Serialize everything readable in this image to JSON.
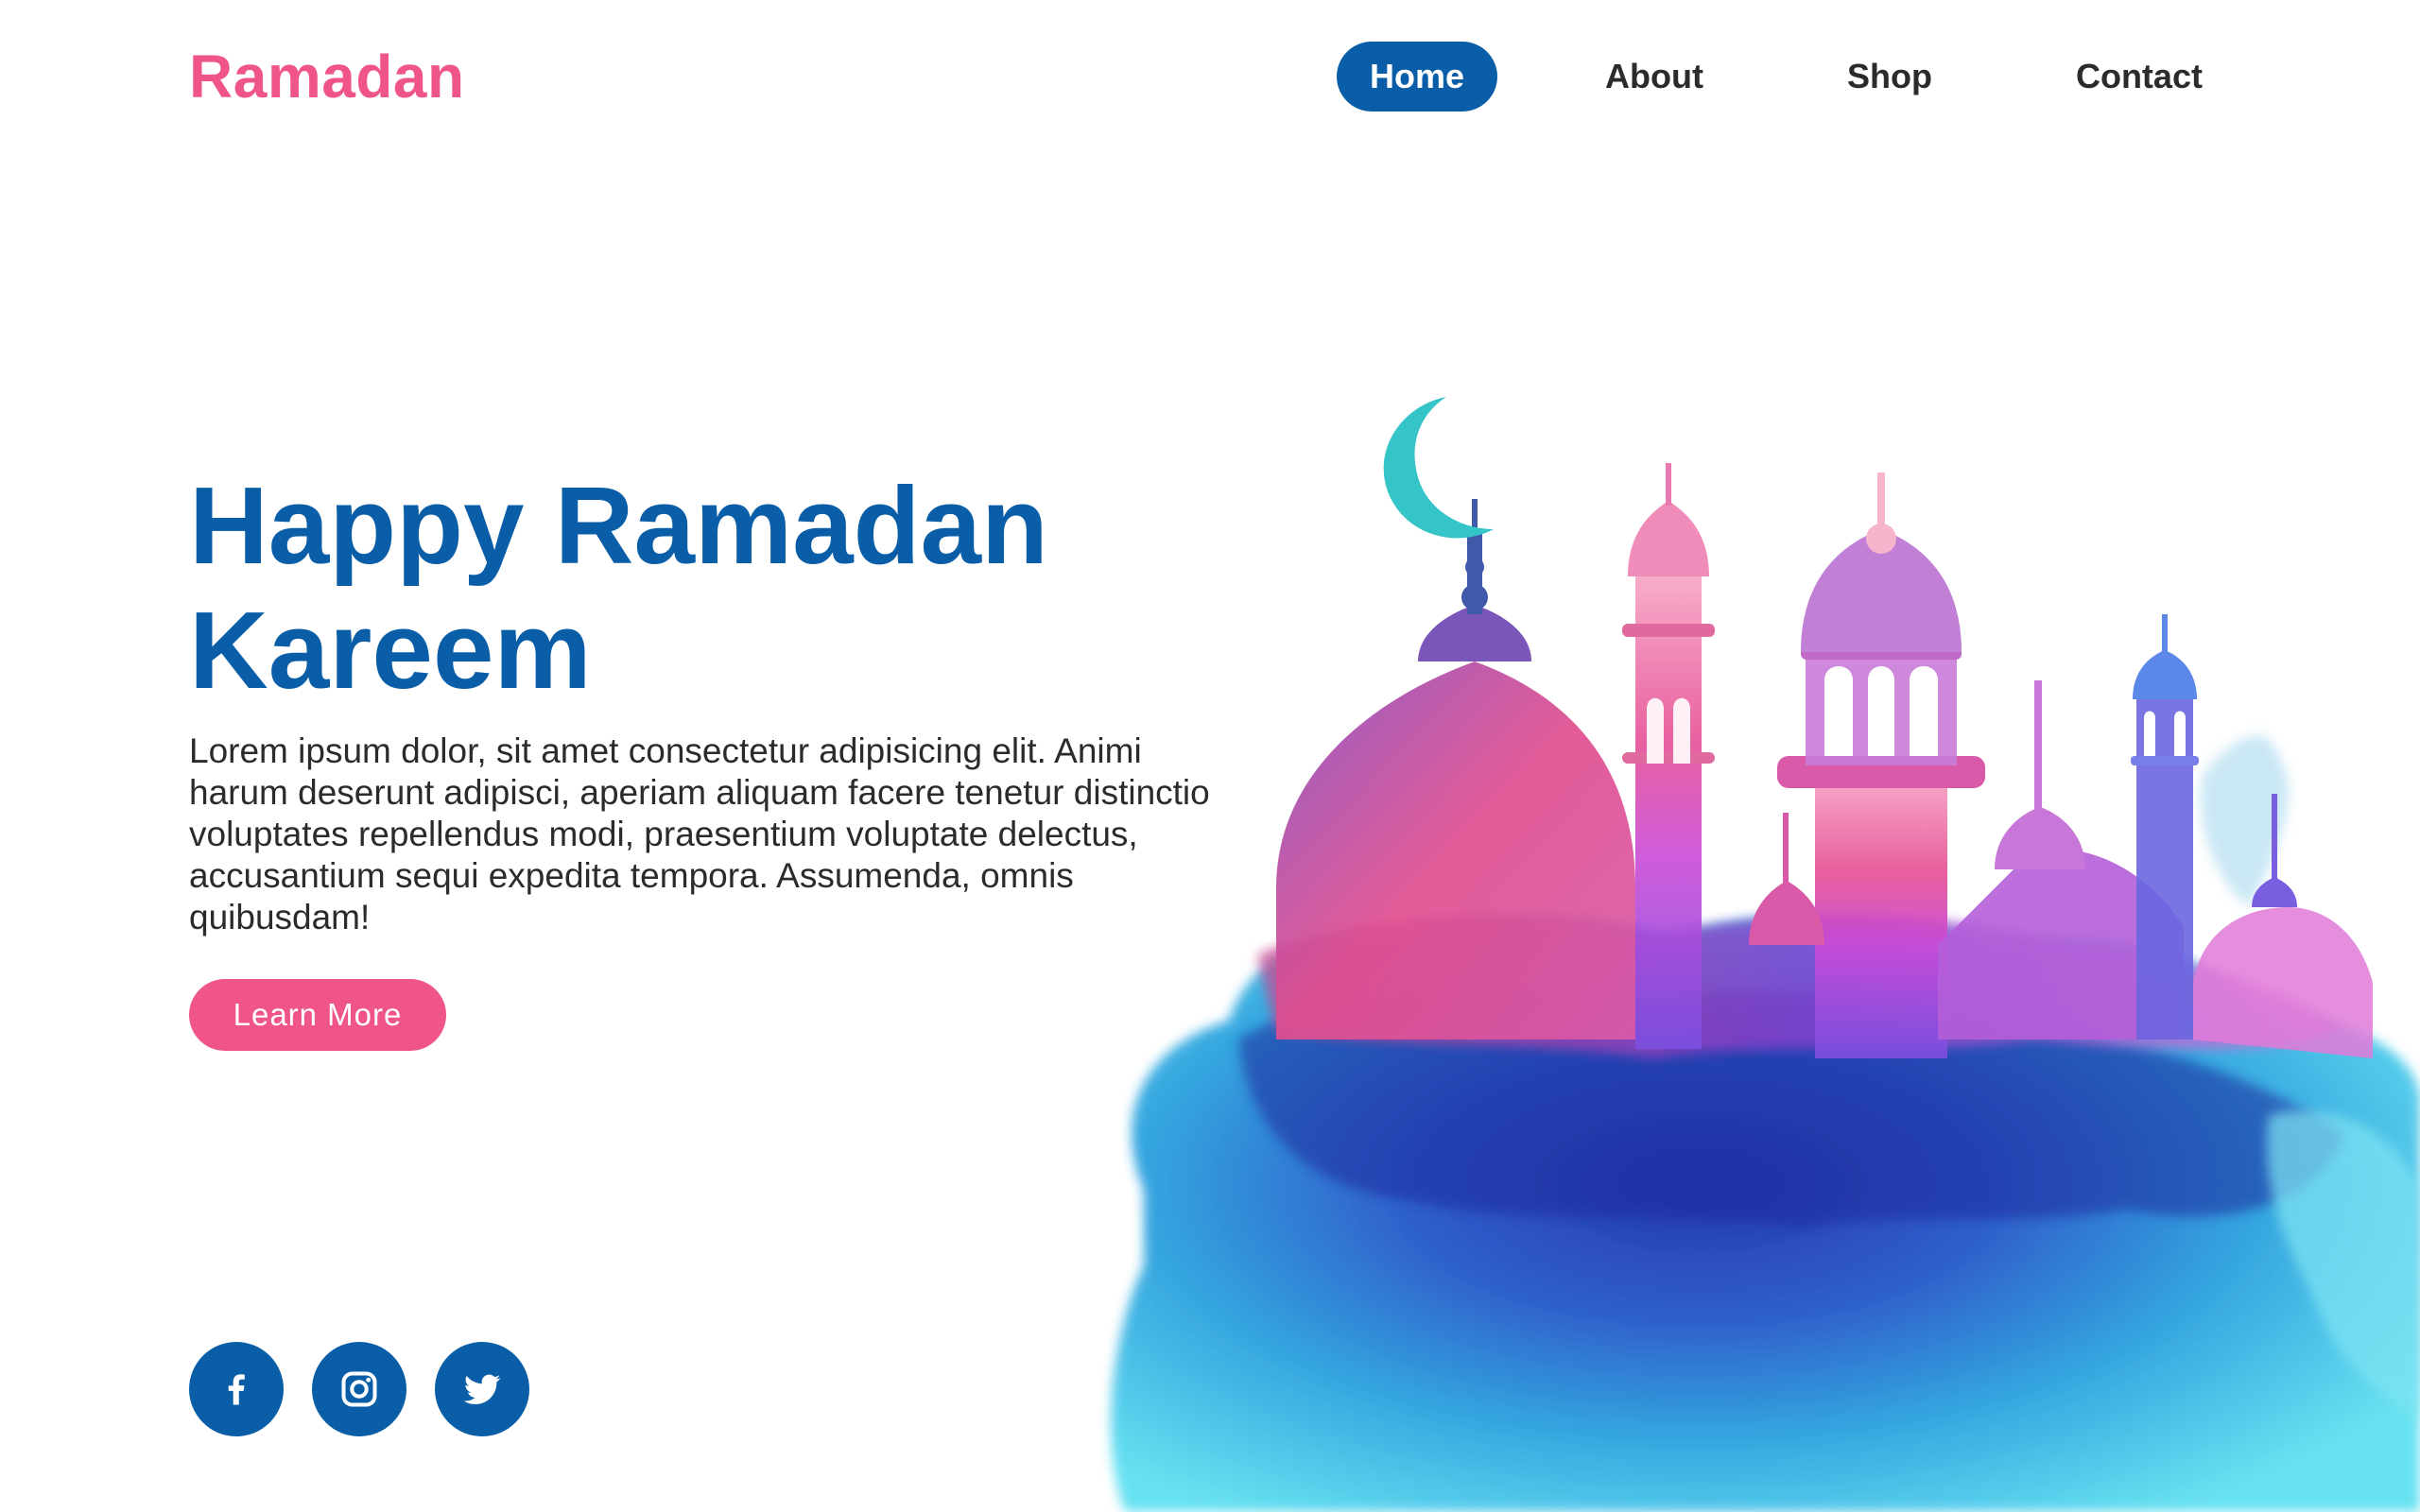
{
  "brand": {
    "name": "Ramadan",
    "color": "#f0558a"
  },
  "nav": {
    "items": [
      {
        "label": "Home",
        "active": true
      },
      {
        "label": "About",
        "active": false
      },
      {
        "label": "Shop",
        "active": false
      },
      {
        "label": "Contact",
        "active": false
      }
    ]
  },
  "hero": {
    "title_line1": "Happy Ramadan",
    "title_line2": "Kareem",
    "body": "Lorem ipsum dolor, sit amet consectetur adipisicing elit. Animi harum deserunt adipisci, aperiam aliquam facere tenetur distinctio voluptates repellendus modi, praesentium voluptate delectus, accusantium sequi expedita tempora. Assumenda, omnis quibusdam!",
    "cta_label": "Learn More"
  },
  "social": {
    "icons": [
      "facebook-icon",
      "instagram-icon",
      "twitter-icon"
    ]
  },
  "illustration": {
    "subject": "mosque-watercolor",
    "icons": [
      "crescent-moon-icon"
    ]
  },
  "colors": {
    "primary": "#0a5ea8",
    "accent": "#f0558a",
    "text": "#2b2b2b",
    "background": "#ffffff"
  }
}
